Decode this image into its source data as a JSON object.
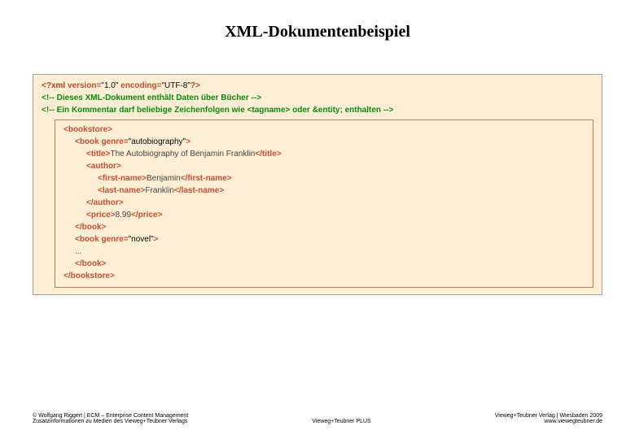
{
  "slide": {
    "title": "XML-Dokumentenbeispiel"
  },
  "xml": {
    "prolog": {
      "open": "<?xml ",
      "version_attr": "version=",
      "version_val": "\"1.0\"",
      "encoding_attr": " encoding=",
      "encoding_val": "\"UTF-8\"",
      "close": "?>"
    },
    "comments": {
      "c1_open": "<!-- ",
      "c1_text": "Dieses XML-Dokument enthält Daten über Bücher",
      "c1_close": " -->",
      "c2_open": "<!-- ",
      "c2_text": "Ein Kommentar darf beliebige Zeichenfolgen wie <tagname> oder &entity; enthalten",
      "c2_close": " -->"
    },
    "body": {
      "bookstore_open": "<bookstore>",
      "book1_open_a": "<book ",
      "book1_genre_attr": "genre=",
      "book1_genre_val": "\"autobiography\"",
      "book1_open_b": ">",
      "title_open": "<title>",
      "title_text": "The Autobiography of Benjamin Franklin",
      "title_close": "</title>",
      "author_open": "<author>",
      "first_open": "<first-name>",
      "first_text": "Benjamin",
      "first_close": "</first-name>",
      "last_open": "<last-name>",
      "last_text": "Franklin",
      "last_close": "</last-name>",
      "author_close": "</author>",
      "price_open": "<price>",
      "price_text": "8.99",
      "price_close": "</price>",
      "book1_close": "</book>",
      "book2_open_a": "<book ",
      "book2_genre_attr": "genre=",
      "book2_genre_val": "\"novel\"",
      "book2_open_b": ">",
      "ellipsis": "...",
      "book2_close": "</book>",
      "bookstore_close": "</bookstore>"
    }
  },
  "footer": {
    "left_line1": "© Wolfgang Riggert | ECM – Enterprise Content Management",
    "left_line2": "Zusatzinformationen zu Medien des Vieweg+Teubner Verlags",
    "center": "Vieweg+Teubner PLUS",
    "right_line1": "Vieweg+Teubner Verlag | Wiesbaden 2009",
    "right_line2": "www.viewegteubner.de"
  }
}
